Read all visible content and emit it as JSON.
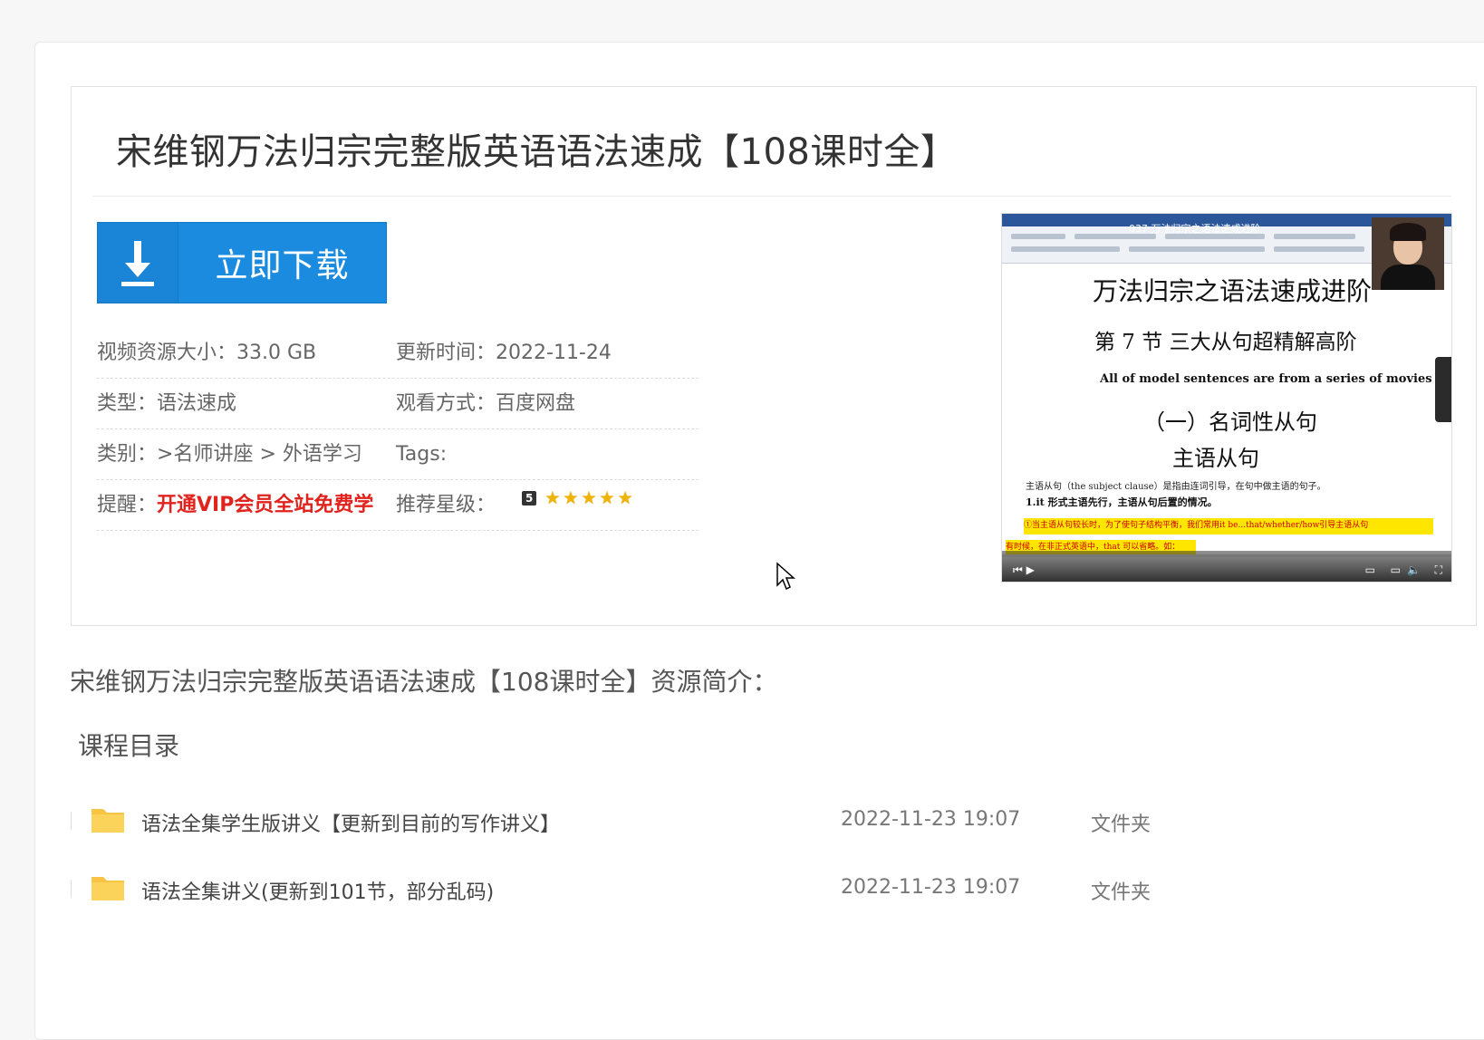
{
  "page_title": "宋维钢万法归宗完整版英语语法速成【108课时全】",
  "download_label": "立即下载",
  "meta": [
    {
      "label": "视频资源大小：",
      "value": "33.0 GB",
      "label2": "更新时间：",
      "value2": "2022-11-24"
    },
    {
      "label": "类型：",
      "value": "语法速成",
      "label2": "观看方式：",
      "value2": "百度网盘"
    },
    {
      "label": "类别：",
      "value": ">名师讲座 > 外语学习",
      "label2": "Tags:",
      "value2": ""
    },
    {
      "label": "提醒：",
      "value": "开通VIP会员全站免费学",
      "label2": "推荐星级：",
      "value2": ""
    }
  ],
  "rating": {
    "badge": "5",
    "stars": 5,
    "star_color": "#f0b400"
  },
  "video": {
    "title_bar": "037 万法归宗之语法速成进阶",
    "slide_title": "万法归宗之语法速成进阶",
    "section": "第 7 节  三大从句超精解高阶",
    "subtitle": "All of model sentences are from a series of movies of MARVEL",
    "heading": "（一）名词性从句",
    "subheading": "主语从句",
    "line1": "主语从句（the subject clause）是指由连词引导，在句中做主语的句子。",
    "line2": "1.it 形式主语先行，主语从句后置的情况。",
    "highlight": "①当主语从句较长时，为了使句子结构平衡，我们常用it be...that/whether/how引导主语从句",
    "highlight2": "有时候，在非正式英语中，that 可以省略。如："
  },
  "intro_text": "宋维钢万法归宗完整版英语语法速成【108课时全】资源简介：",
  "toc_title": "课程目录",
  "files": [
    {
      "name": "语法全集学生版讲义【更新到目前的写作讲义】",
      "date": "2022-11-23 19:07",
      "kind": "文件夹",
      "icon": "folder-icon"
    },
    {
      "name": "语法全集讲义(更新到101节，部分乱码)",
      "date": "2022-11-23 19:07",
      "kind": "文件夹",
      "icon": "folder-icon"
    }
  ],
  "colors": {
    "accent": "#1b8be0",
    "vip": "#e0231d",
    "folder": "#f7c443"
  }
}
